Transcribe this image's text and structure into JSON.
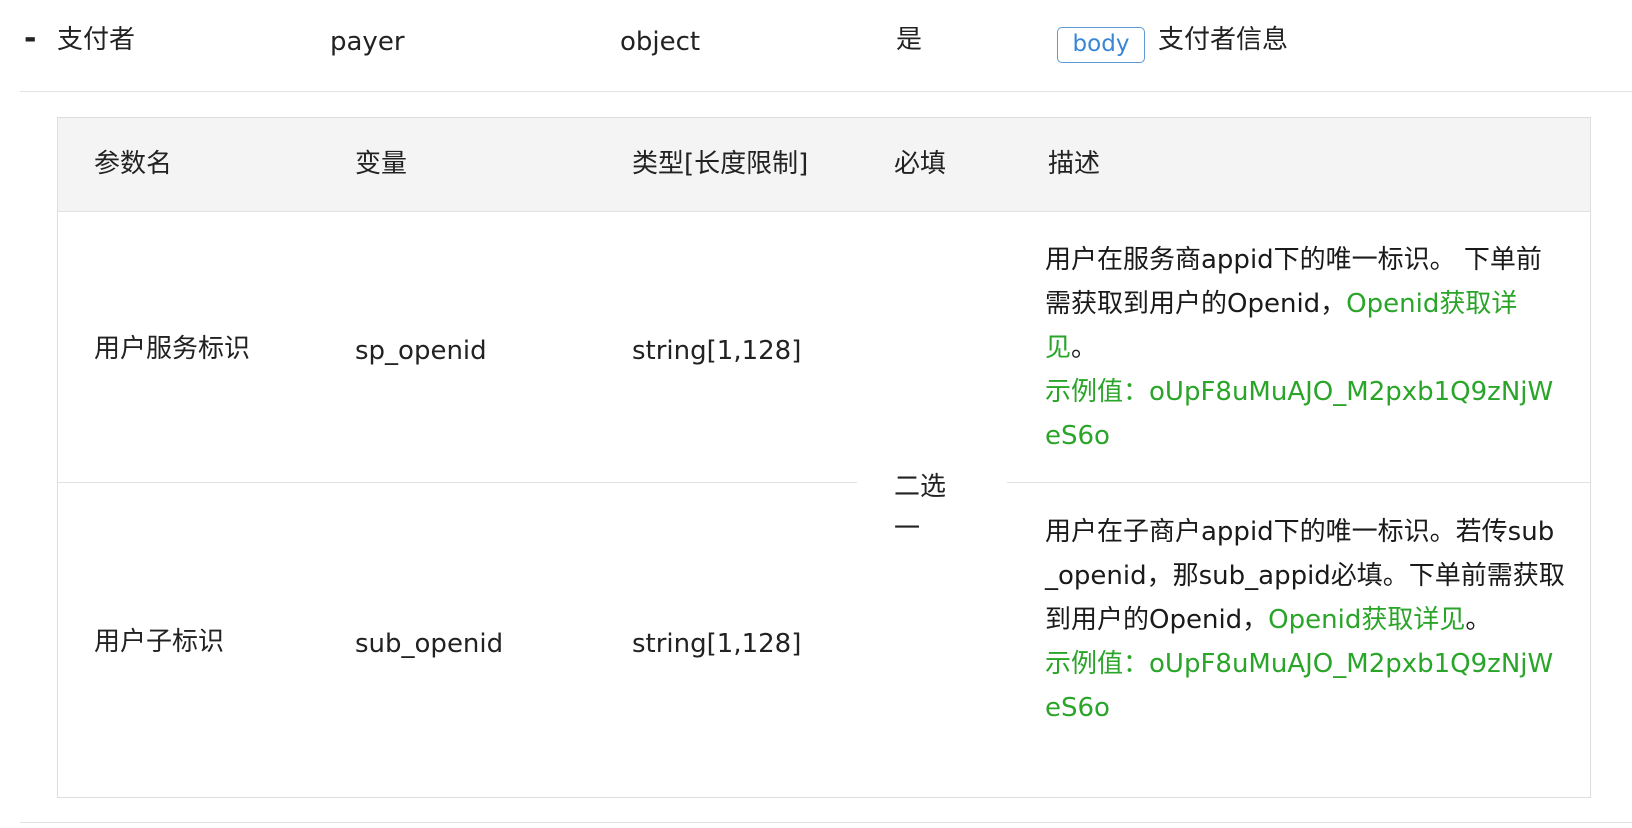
{
  "param": {
    "collapse_symbol": "-",
    "name": "支付者",
    "variable": "payer",
    "type": "object",
    "required": "是",
    "location_badge": "body",
    "description": "支付者信息"
  },
  "table": {
    "headers": [
      "参数名",
      "变量",
      "类型[长度限制]",
      "必填",
      "描述"
    ],
    "required_merged": "二选一",
    "rows": [
      {
        "name": "用户服务标识",
        "variable": "sp_openid",
        "type": "string[1,128]",
        "desc_text": "用户在服务商appid下的唯一标识。 下单前需获取到用户的Openid，",
        "desc_link": "Openid获取详见",
        "desc_end": "。",
        "example_label": "示例值：",
        "example_value": "oUpF8uMuAJO_M2pxb1Q9zNjWeS6o"
      },
      {
        "name": "用户子标识",
        "variable": "sub_openid",
        "type": "string[1,128]",
        "desc_text": "用户在子商户appid下的唯一标识。若传sub_openid，那sub_appid必填。下单前需获取到用户的Openid，",
        "desc_link": "Openid获取详见",
        "desc_end": "。",
        "example_label": "示例值：",
        "example_value": "oUpF8uMuAJO_M2pxb1Q9zNjWeS6o"
      }
    ]
  },
  "colors": {
    "link_green": "#2aa52a",
    "badge_blue": "#3a86d4",
    "header_bg": "#f4f4f4"
  }
}
